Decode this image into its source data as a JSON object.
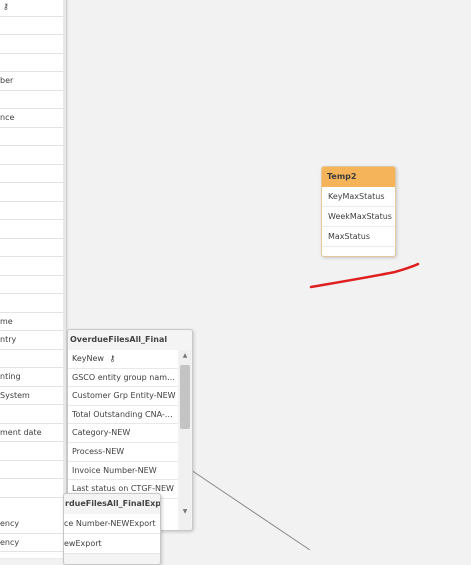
{
  "left_table": {
    "rows": [
      "",
      "",
      "",
      "",
      "ber",
      "",
      "nce",
      "",
      "",
      "",
      "",
      "",
      "",
      "",
      "",
      "",
      "",
      "me",
      "ntry",
      "",
      "nting",
      "System",
      "",
      "ment date",
      "",
      "",
      "",
      "ency",
      "ency"
    ]
  },
  "temp2": {
    "title": "Temp2",
    "fields": [
      "KeyMaxStatus",
      "WeekMaxStatus",
      "MaxStatus"
    ]
  },
  "overdue_final": {
    "title": "OverdueFilesAll_Final",
    "fields": [
      "KeyNew",
      "GSCO entity group nam…",
      "Customer Grp Entity-NEW",
      "Total Outstanding CNA-…",
      "Category-NEW",
      "Process-NEW",
      "Invoice Number-NEW",
      "Last status on CTGF-NEW"
    ]
  },
  "overdue_export": {
    "title": "rdueFilesAll_FinalExport",
    "fields": [
      "ce Number-NEWExport",
      "ewExport"
    ]
  },
  "colors": {
    "canvas": "#f2f2f2",
    "temp2_header": "#f5b45a",
    "annotation": "#e02020"
  },
  "icons": {
    "key": "key-icon",
    "scroll_up": "chevron-up-icon",
    "scroll_down": "chevron-down-icon"
  }
}
